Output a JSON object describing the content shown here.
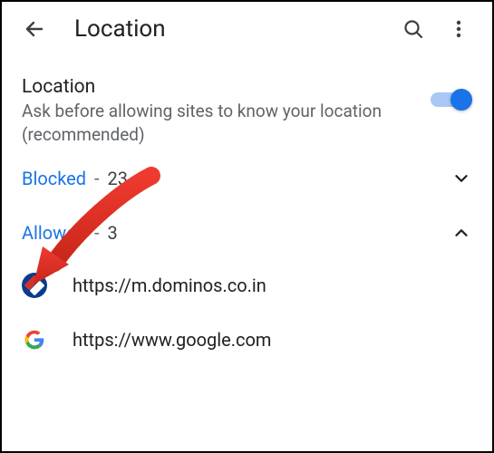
{
  "header": {
    "title": "Location"
  },
  "setting": {
    "title": "Location",
    "description": "Ask before allowing sites to know your location (recommended)",
    "toggle_on": true
  },
  "sections": {
    "blocked": {
      "label": "Blocked",
      "count": "23",
      "expanded": false
    },
    "allowed": {
      "label": "Allowed",
      "count": "3",
      "expanded": true
    }
  },
  "allowed_sites": [
    {
      "icon": "dominos",
      "url": "https://m.dominos.co.in"
    },
    {
      "icon": "google",
      "url": "https://www.google.com"
    }
  ]
}
